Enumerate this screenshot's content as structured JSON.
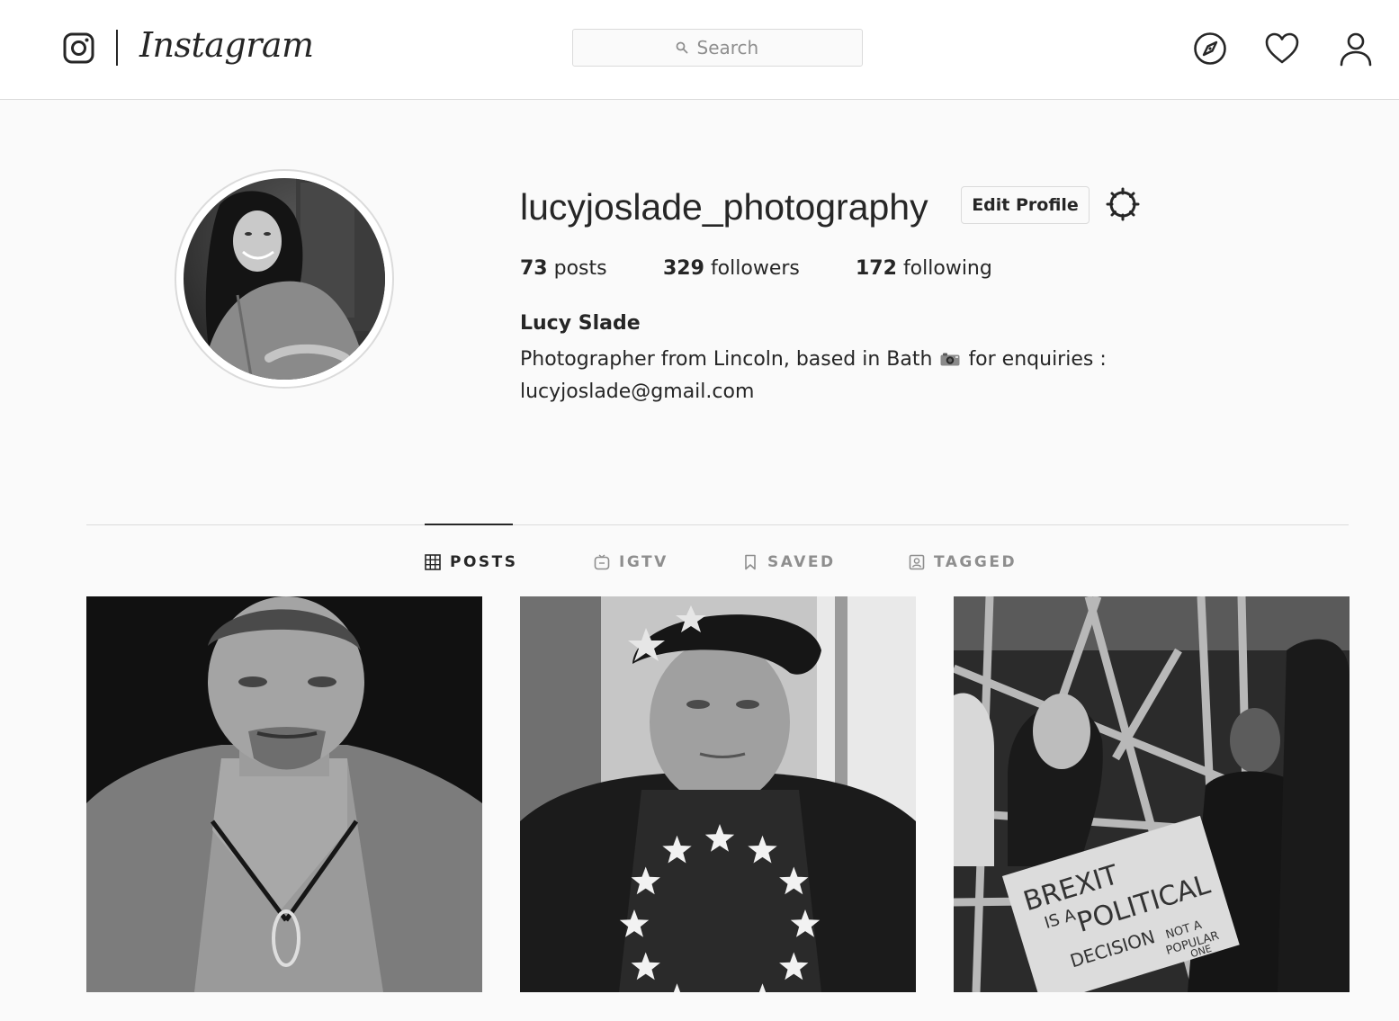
{
  "header": {
    "wordmark": "Instagram",
    "search_placeholder": "Search",
    "icons": [
      "camera-logo-icon",
      "compass-icon",
      "heart-icon",
      "user-icon"
    ]
  },
  "profile": {
    "username": "lucyjoslade_photography",
    "edit_label": "Edit Profile",
    "stats": {
      "posts_count": "73",
      "posts_label": "posts",
      "followers_count": "329",
      "followers_label": "followers",
      "following_count": "172",
      "following_label": "following"
    },
    "full_name": "Lucy Slade",
    "bio_line1_before": "Photographer from Lincoln, based in Bath",
    "bio_line1_after": "for enquiries :",
    "bio_line2": "lucyjoslade@gmail.com"
  },
  "tabs": [
    {
      "label": "POSTS",
      "icon": "grid-icon",
      "active": true
    },
    {
      "label": "IGTV",
      "icon": "tv-icon",
      "active": false
    },
    {
      "label": "SAVED",
      "icon": "bookmark-icon",
      "active": false
    },
    {
      "label": "TAGGED",
      "icon": "tag-person-icon",
      "active": false
    }
  ],
  "posts": {
    "sign_text": [
      "BREXIT",
      "IS A",
      "POLITICAL",
      "DECISION",
      "NOT A",
      "POPULAR",
      "ONE"
    ]
  },
  "colors": {
    "text": "#262626",
    "muted": "#8e8e8e",
    "border": "#dbdbdb",
    "background": "#fafafa"
  }
}
